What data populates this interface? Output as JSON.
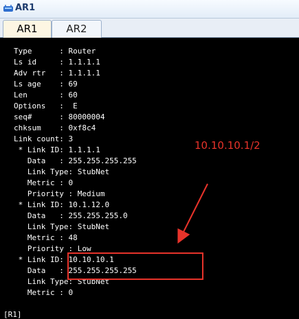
{
  "window": {
    "title": "AR1"
  },
  "tabs": [
    {
      "label": "AR1",
      "active": true
    },
    {
      "label": "AR2",
      "active": false
    }
  ],
  "terminal": {
    "lines": [
      "Type      : Router",
      "Ls id     : 1.1.1.1",
      "Adv rtr   : 1.1.1.1",
      "Ls age    : 69",
      "Len       : 60",
      "Options   :  E",
      "seq#      : 80000004",
      "chksum    : 0xf8c4",
      "Link count: 3",
      " * Link ID: 1.1.1.1",
      "   Data   : 255.255.255.255",
      "   Link Type: StubNet",
      "   Metric : 0",
      "   Priority : Medium",
      " * Link ID: 10.1.12.0",
      "   Data   : 255.255.255.0",
      "   Link Type: StubNet",
      "   Metric : 48",
      "   Priority : Low",
      " * Link ID: 10.10.10.1",
      "   Data   : 255.255.255.255",
      "   Link Type: StubNet",
      "   Metric : 0"
    ],
    "prompt": "[R1]"
  },
  "annotation": {
    "text": "10.10.10.1/2",
    "color": "#e8332a"
  },
  "icons": {
    "app_icon": "router-app-icon"
  }
}
